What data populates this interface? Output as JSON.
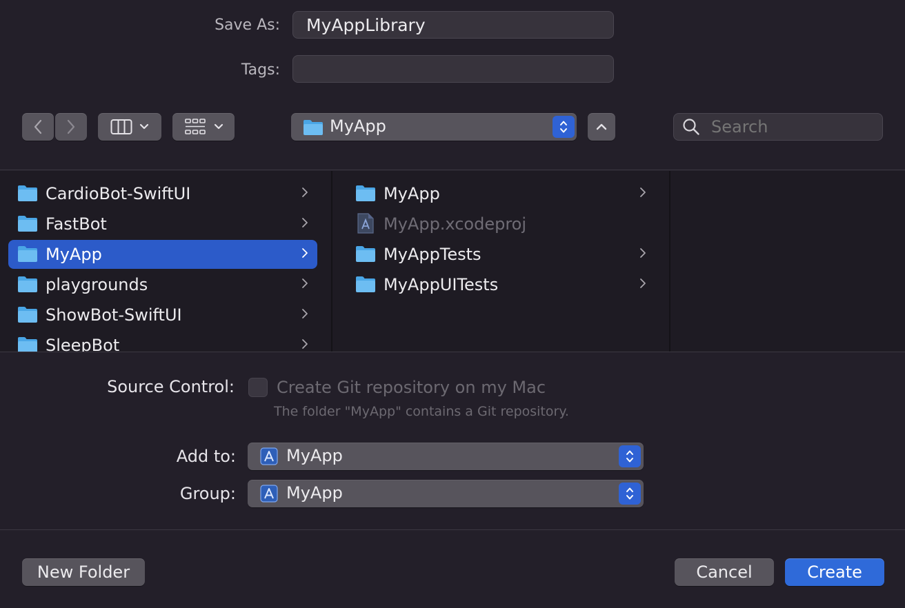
{
  "save_as": {
    "label": "Save As:",
    "value": "MyAppLibrary"
  },
  "tags": {
    "label": "Tags:",
    "value": ""
  },
  "toolbar": {
    "location": "MyApp",
    "search_placeholder": "Search"
  },
  "browser": {
    "column1": [
      {
        "name": "CardioBot-SwiftUI",
        "type": "folder",
        "selected": false
      },
      {
        "name": "FastBot",
        "type": "folder",
        "selected": false
      },
      {
        "name": "MyApp",
        "type": "folder",
        "selected": true
      },
      {
        "name": "playgrounds",
        "type": "folder",
        "selected": false
      },
      {
        "name": "ShowBot-SwiftUI",
        "type": "folder",
        "selected": false
      },
      {
        "name": "SleepBot",
        "type": "folder",
        "selected": false
      }
    ],
    "column2": [
      {
        "name": "MyApp",
        "type": "folder"
      },
      {
        "name": "MyApp.xcodeproj",
        "type": "xcodeproj",
        "disabled": true
      },
      {
        "name": "MyAppTests",
        "type": "folder"
      },
      {
        "name": "MyAppUITests",
        "type": "folder"
      }
    ]
  },
  "source_control": {
    "label": "Source Control:",
    "checkbox_label": "Create Git repository on my Mac",
    "note": "The folder \"MyApp\" contains a Git repository.",
    "checked": false
  },
  "add_to": {
    "label": "Add to:",
    "value": "MyApp"
  },
  "group": {
    "label": "Group:",
    "value": "MyApp"
  },
  "buttons": {
    "new_folder": "New Folder",
    "cancel": "Cancel",
    "create": "Create"
  },
  "colors": {
    "accent": "#2f6ad9",
    "background": "#231f29",
    "selection": "#2c5bc9"
  }
}
